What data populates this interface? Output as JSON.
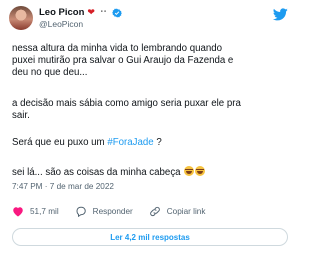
{
  "tweet": {
    "display_name": "Leo Picon",
    "handle": "@LeoPicon",
    "paragraphs": {
      "p1_line1": "nessa altura da minha vida to lembrando quando",
      "p1_line2": "puxei mutirão pra salvar o Gui Araujo da Fazenda e",
      "p1_line3": "deu no que deu...",
      "p2_line1": "a decisão mais sábia como amigo seria puxar ele pra",
      "p2_line2": "sair.",
      "p3_before": "Será que eu puxo um ",
      "p3_hashtag": "#ForaJade",
      "p3_after": " ?",
      "p4_text": "sei lá... são as coisas da minha cabeça"
    },
    "timestamp": "7:47 PM · 7 de mar de 2022"
  },
  "actions": {
    "likes": "51,7 mil",
    "reply_label": "Responder",
    "copy_label": "Copiar link"
  },
  "read_replies_label": "Ler 4,2 mil respostas",
  "icons": [
    "heart-emoji-icon",
    "verified-badge-icon",
    "twitter-bird-icon",
    "like-heart-icon",
    "reply-icon",
    "link-icon",
    "laughing-emoji-icon"
  ],
  "colors": {
    "accent": "#1d9bf0",
    "heart": "#d61f26",
    "muted": "#536471"
  }
}
